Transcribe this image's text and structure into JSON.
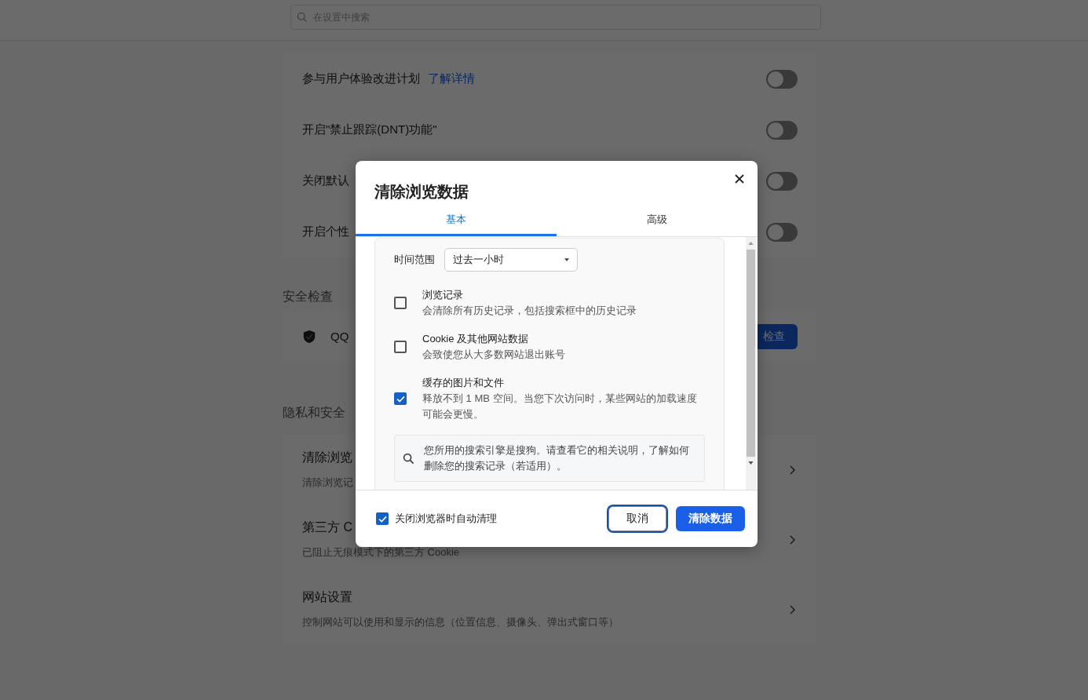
{
  "header": {
    "search": {
      "placeholder": "在设置中搜索"
    }
  },
  "toggle_rows": [
    {
      "label": "参与用户体验改进计划",
      "link": "了解详情",
      "on": false
    },
    {
      "label": "开启\"禁止跟踪(DNT)功能\"",
      "on": false
    },
    {
      "label": "关闭默认",
      "on": false
    },
    {
      "label": "开启个性",
      "on": false
    }
  ],
  "safety_check": {
    "heading": "安全检查",
    "label": "QQ",
    "button": "检查"
  },
  "privacy": {
    "heading": "隐私和安全",
    "items": [
      {
        "title": "清除浏览",
        "subtitle": "清除浏览记"
      },
      {
        "title": "第三方 C",
        "subtitle": "已阻止无痕模式下的第三方 Cookie"
      },
      {
        "title": "网站设置",
        "subtitle": "控制网站可以使用和显示的信息（位置信息、摄像头、弹出式窗口等）"
      }
    ]
  },
  "dialog": {
    "title": "清除浏览数据",
    "tabs": [
      {
        "label": "基本",
        "selected": true
      },
      {
        "label": "高级",
        "selected": false
      }
    ],
    "time_range": {
      "label": "时间范围",
      "value": "过去一小时"
    },
    "items": [
      {
        "title": "浏览记录",
        "description": "会清除所有历史记录，包括搜索框中的历史记录",
        "checked": false
      },
      {
        "title": "Cookie 及其他网站数据",
        "description": "会致使您从大多数网站退出账号",
        "checked": false
      },
      {
        "title": "缓存的图片和文件",
        "description": "释放不到 1 MB 空间。当您下次访问时，某些网站的加载速度可能会更慢。",
        "checked": true
      }
    ],
    "notice": "您所用的搜索引擎是搜狗。请查看它的相关说明，了解如何删除您的搜索记录（若适用）。",
    "auto_clear": {
      "label": "关闭浏览器时自动清理",
      "checked": true
    },
    "buttons": [
      {
        "label": "取消",
        "kind": "secondary"
      },
      {
        "label": "清除数据",
        "kind": "primary"
      }
    ]
  }
}
